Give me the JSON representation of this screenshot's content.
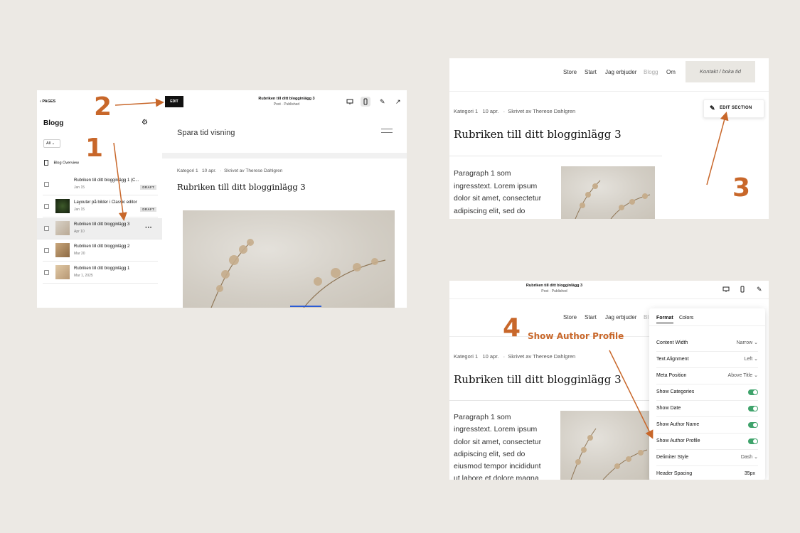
{
  "colors": {
    "accent": "#c8672a",
    "toggle_on": "#3fa36b",
    "background": "#ece9e4"
  },
  "panel1": {
    "back_label": "PAGES",
    "section_title": "Blogg",
    "filter_value": "All",
    "overview_label": "Blog Overview",
    "edit_label": "EDIT",
    "post_title": "Rubriken till ditt blogginlägg 3",
    "post_status": "Post · Published",
    "site_title": "Spara tid visning",
    "meta": "Kategori 1   10 apr.   ·  Skrivet av Therese Dahlgren",
    "heading": "Rubriken till ditt blogginlägg 3",
    "posts": [
      {
        "title": "Rubriken till ditt blogginlägg 1 (C...",
        "date": "Jan 15",
        "badge": "DRAFT"
      },
      {
        "title": "Layouter på bilder i Classic editor",
        "date": "Jan 15",
        "badge": "DRAFT"
      },
      {
        "title": "Rubriken till ditt blogginlägg 3",
        "date": "Apr 10",
        "badge": ""
      },
      {
        "title": "Rubriken till ditt blogginlägg 2",
        "date": "Mar 20",
        "badge": ""
      },
      {
        "title": "Rubriken till ditt blogginlägg 1",
        "date": "Mar 1, 2025",
        "badge": ""
      }
    ]
  },
  "panel2": {
    "nav": [
      "Store",
      "Start",
      "Jag erbjuder",
      "Blogg",
      "Om"
    ],
    "cta": "Kontakt / boka tid",
    "edit_section_label": "EDIT SECTION",
    "meta": "Kategori 1   10 apr.   ·  Skrivet av Therese Dahlgren",
    "heading": "Rubriken till ditt blogginlägg 3",
    "paragraph_lines": [
      "Paragraph 1 som",
      "ingresstext. Lorem ipsum",
      "dolor sit amet, consectetur",
      "adipiscing elit, sed do"
    ]
  },
  "panel3": {
    "post_title": "Rubriken till ditt blogginlägg 3",
    "post_status": "Post · Published",
    "nav": [
      "Store",
      "Start",
      "Jag erbjuder",
      "Bl"
    ],
    "meta": "Kategori 1   10 apr.   ·  Skrivet av Therese Dahlgren",
    "heading": "Rubriken till ditt blogginlägg 3",
    "paragraph_lines": [
      "Paragraph 1 som",
      "ingresstext. Lorem ipsum",
      "dolor sit amet, consectetur",
      "adipiscing elit, sed do",
      "eiusmod tempor incididunt",
      "ut labore et dolore magna"
    ],
    "tabs": [
      "Format",
      "Colors"
    ],
    "settings": [
      {
        "label": "Content Width",
        "value": "Narrow",
        "type": "select"
      },
      {
        "label": "Text Alignment",
        "value": "Left",
        "type": "select"
      },
      {
        "label": "Meta Position",
        "value": "Above Title",
        "type": "select"
      },
      {
        "label": "Show Categories",
        "value": "on",
        "type": "toggle"
      },
      {
        "label": "Show Date",
        "value": "on",
        "type": "toggle"
      },
      {
        "label": "Show Author Name",
        "value": "on",
        "type": "toggle"
      },
      {
        "label": "Show Author Profile",
        "value": "on",
        "type": "toggle"
      },
      {
        "label": "Delimiter Style",
        "value": "Dash",
        "type": "select"
      },
      {
        "label": "Header Spacing",
        "value": "35px",
        "type": "value"
      }
    ]
  },
  "annotations": {
    "step1": "1",
    "step2": "2",
    "step3": "3",
    "step4": "4",
    "step4_label": "Show Author Profile"
  }
}
